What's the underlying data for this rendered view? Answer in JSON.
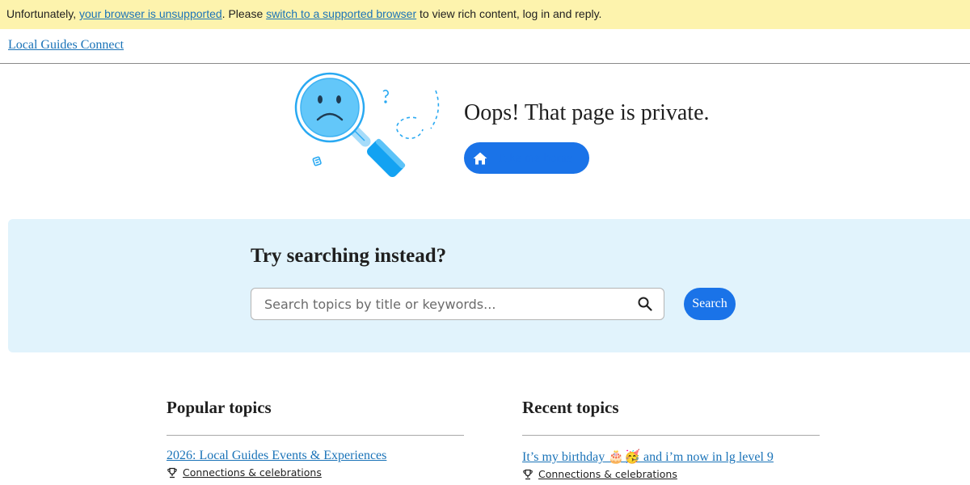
{
  "banner": {
    "prefix": "Unfortunately, ",
    "link_unsupported": "your browser is unsupported",
    "middle": ". Please ",
    "link_switch": "switch to a supported browser",
    "suffix": " to view rich content, log in and reply."
  },
  "header": {
    "site_title": "Local Guides Connect"
  },
  "error": {
    "title": "Oops! That page is private.",
    "home_button_label": "Take me home",
    "illustration_icon": "sad-magnifier-icon"
  },
  "search": {
    "heading": "Try searching instead?",
    "placeholder": "Search topics by title or keywords...",
    "value": "",
    "button_label": "Search"
  },
  "popular_topics": {
    "heading": "Popular topics",
    "items": [
      {
        "title": "2026: Local Guides Events & Experiences",
        "category": "Connections & celebrations"
      }
    ]
  },
  "recent_topics": {
    "heading": "Recent topics",
    "items": [
      {
        "title": "It’s my birthday 🎂🥳 and i’m now in lg level 9",
        "category": "Connections & celebrations"
      }
    ]
  },
  "colors": {
    "banner_bg": "#fdf3ad",
    "link": "#1a73b8",
    "accent": "#1a73e8",
    "search_panel_bg": "#e1f3fc",
    "illustration_blue": "#29a9f2"
  }
}
